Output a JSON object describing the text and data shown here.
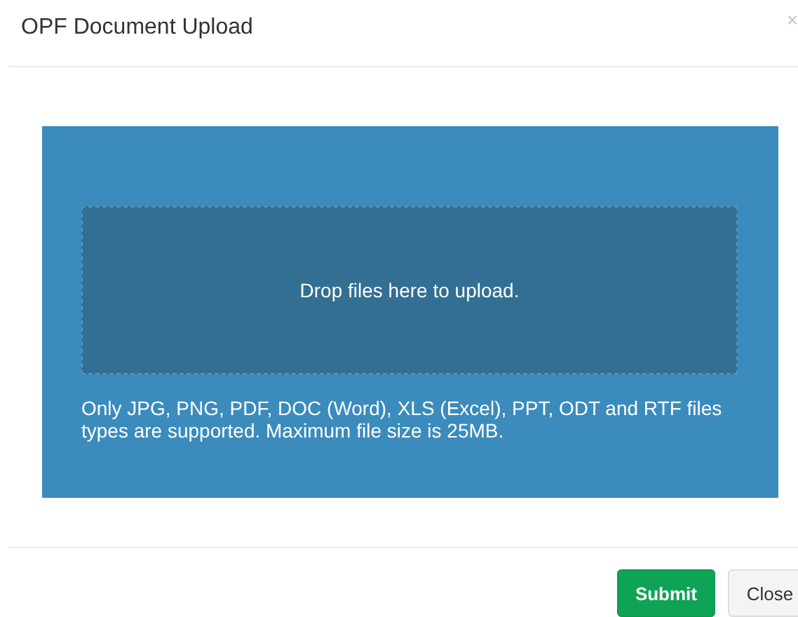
{
  "modal": {
    "title": "OPF Document Upload",
    "close_glyph": "×"
  },
  "upload": {
    "dropzone_text": "Drop files here to upload.",
    "note": "Only JPG, PNG, PDF, DOC (Word), XLS (Excel), PPT, ODT and RTF files types are supported. Maximum file size is 25MB."
  },
  "buttons": [
    {
      "label": "Submit",
      "kind": "primary"
    },
    {
      "label": "Close",
      "kind": "default"
    }
  ]
}
